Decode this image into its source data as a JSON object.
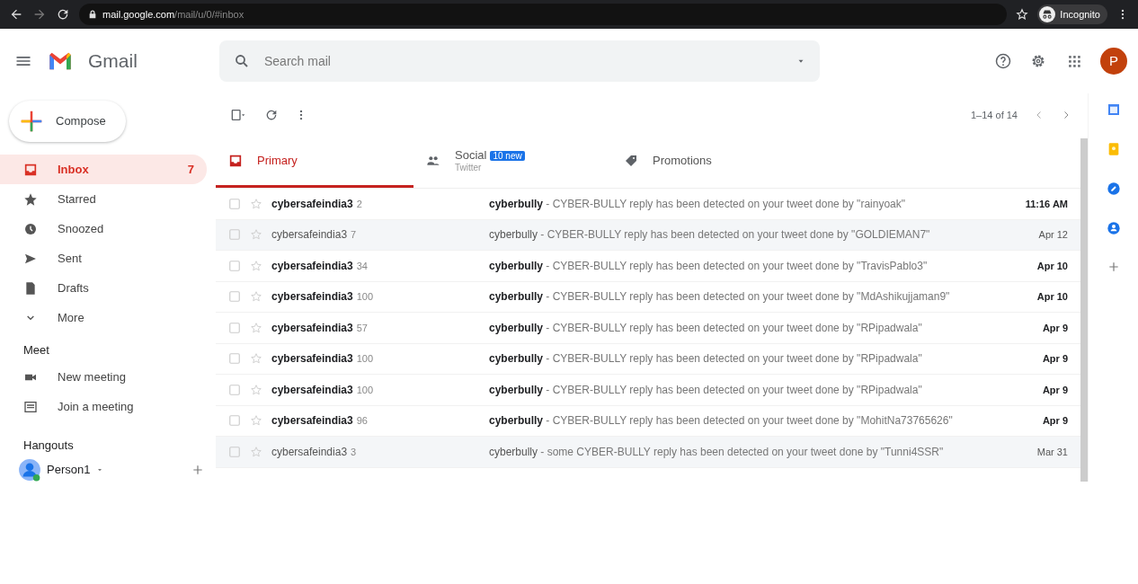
{
  "browser": {
    "url_host": "mail.google.com",
    "url_path": "/mail/u/0/#inbox",
    "profile": "Incognito"
  },
  "header": {
    "app_name": "Gmail",
    "search": {
      "placeholder": "Search mail"
    },
    "avatar_letter": "P"
  },
  "compose": {
    "label": "Compose"
  },
  "sidebar": {
    "items": [
      {
        "label": "Inbox",
        "count": "7",
        "selected": true
      },
      {
        "label": "Starred",
        "selected": false
      },
      {
        "label": "Snoozed",
        "selected": false
      },
      {
        "label": "Sent",
        "selected": false
      },
      {
        "label": "Drafts",
        "selected": false
      },
      {
        "label": "More",
        "selected": false
      }
    ],
    "meet": {
      "title": "Meet",
      "items": [
        {
          "label": "New meeting"
        },
        {
          "label": "Join a meeting"
        }
      ]
    },
    "hangouts": {
      "title": "Hangouts",
      "user": "Person1"
    }
  },
  "toolbar": {
    "pagination": "1–14 of 14"
  },
  "tabs": [
    {
      "label": "Primary",
      "selected": true
    },
    {
      "label": "Social",
      "badge": "10 new",
      "subtitle": "Twitter",
      "selected": false
    },
    {
      "label": "Promotions",
      "selected": false
    }
  ],
  "messages": [
    {
      "sender": "cybersafeindia3",
      "count": "2",
      "subject": "cyberbully",
      "snippet": " - CYBER-BULLY reply has been detected on your tweet done by \"rainyoak\"",
      "date": "11:16 AM",
      "unread": true
    },
    {
      "sender": "cybersafeindia3",
      "count": "7",
      "subject": "cyberbully",
      "snippet": " - CYBER-BULLY reply has been detected on your tweet done by \"GOLDIEMAN7\"",
      "date": "Apr 12",
      "unread": false
    },
    {
      "sender": "cybersafeindia3",
      "count": "34",
      "subject": "cyberbully",
      "snippet": " - CYBER-BULLY reply has been detected on your tweet done by \"TravisPablo3\"",
      "date": "Apr 10",
      "unread": true
    },
    {
      "sender": "cybersafeindia3",
      "count": "100",
      "subject": "cyberbully",
      "snippet": " - CYBER-BULLY reply has been detected on your tweet done by \"MdAshikujjaman9\"",
      "date": "Apr 10",
      "unread": true
    },
    {
      "sender": "cybersafeindia3",
      "count": "57",
      "subject": "cyberbully",
      "snippet": " - CYBER-BULLY reply has been detected on your tweet done by \"RPipadwala\"",
      "date": "Apr 9",
      "unread": true
    },
    {
      "sender": "cybersafeindia3",
      "count": "100",
      "subject": "cyberbully",
      "snippet": " - CYBER-BULLY reply has been detected on your tweet done by \"RPipadwala\"",
      "date": "Apr 9",
      "unread": true
    },
    {
      "sender": "cybersafeindia3",
      "count": "100",
      "subject": "cyberbully",
      "snippet": " - CYBER-BULLY reply has been detected on your tweet done by \"RPipadwala\"",
      "date": "Apr 9",
      "unread": true
    },
    {
      "sender": "cybersafeindia3",
      "count": "96",
      "subject": "cyberbully",
      "snippet": " - CYBER-BULLY reply has been detected on your tweet done by \"MohitNa73765626\"",
      "date": "Apr 9",
      "unread": true
    },
    {
      "sender": "cybersafeindia3",
      "count": "3",
      "subject": "cyberbully",
      "snippet": " - some CYBER-BULLY reply has been detected on your tweet done by \"Tunni4SSR\"",
      "date": "Mar 31",
      "unread": false
    }
  ]
}
